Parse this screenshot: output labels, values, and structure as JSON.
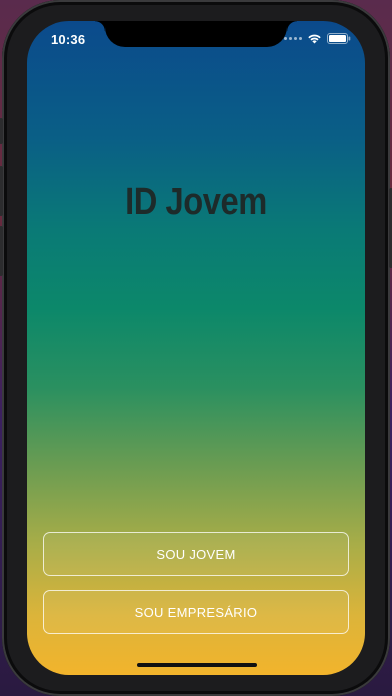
{
  "status_bar": {
    "time": "10:36",
    "icons": [
      "signal-dots-icon",
      "wifi-icon",
      "battery-icon"
    ]
  },
  "app": {
    "title": "ID Jovem",
    "buttons": {
      "jovem_label": "SOU JOVEM",
      "empresario_label": "SOU EMPRESÁRIO"
    }
  },
  "colors": {
    "gradient_top": "#0b4a8c",
    "gradient_middle": "#0c886a",
    "gradient_bottom": "#f2b42c",
    "title_color": "#1d2b2a",
    "button_border": "#ffffff"
  }
}
